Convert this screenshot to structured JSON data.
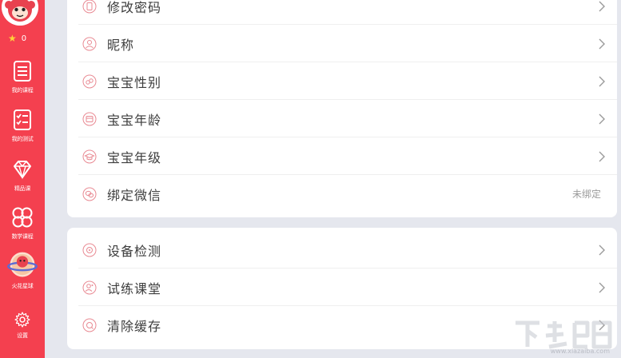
{
  "sidebar": {
    "star_count": "0",
    "items": [
      {
        "label": "我的课程",
        "icon": "course-list-icon"
      },
      {
        "label": "我的测试",
        "icon": "test-checklist-icon"
      },
      {
        "label": "精品课",
        "icon": "diamond-icon"
      },
      {
        "label": "数学课程",
        "icon": "clover-grid-icon"
      },
      {
        "label": "火花星球",
        "icon": "planet-icon"
      },
      {
        "label": "设置",
        "icon": "gear-icon"
      }
    ]
  },
  "settings": {
    "group1": [
      {
        "label": "修改密码",
        "icon": "phone-lock-icon",
        "action": "chevron"
      },
      {
        "label": "昵称",
        "icon": "user-icon",
        "action": "chevron"
      },
      {
        "label": "宝宝性别",
        "icon": "gender-icon",
        "action": "chevron"
      },
      {
        "label": "宝宝年龄",
        "icon": "calendar-icon",
        "action": "chevron"
      },
      {
        "label": "宝宝年级",
        "icon": "grad-cap-icon",
        "action": "chevron"
      },
      {
        "label": "绑定微信",
        "icon": "wechat-icon",
        "value": "未绑定"
      }
    ],
    "group2": [
      {
        "label": "设备检测",
        "icon": "device-check-icon",
        "action": "chevron"
      },
      {
        "label": "试练课堂",
        "icon": "practice-icon",
        "action": "chevron"
      },
      {
        "label": "清除缓存",
        "icon": "clear-cache-icon",
        "action": "chevron"
      }
    ]
  },
  "colors": {
    "accent": "#f4404f",
    "background": "#e5e7ee",
    "icon_pink": "#e98a93"
  },
  "watermark": {
    "text": "www.xiazaiba.com"
  }
}
